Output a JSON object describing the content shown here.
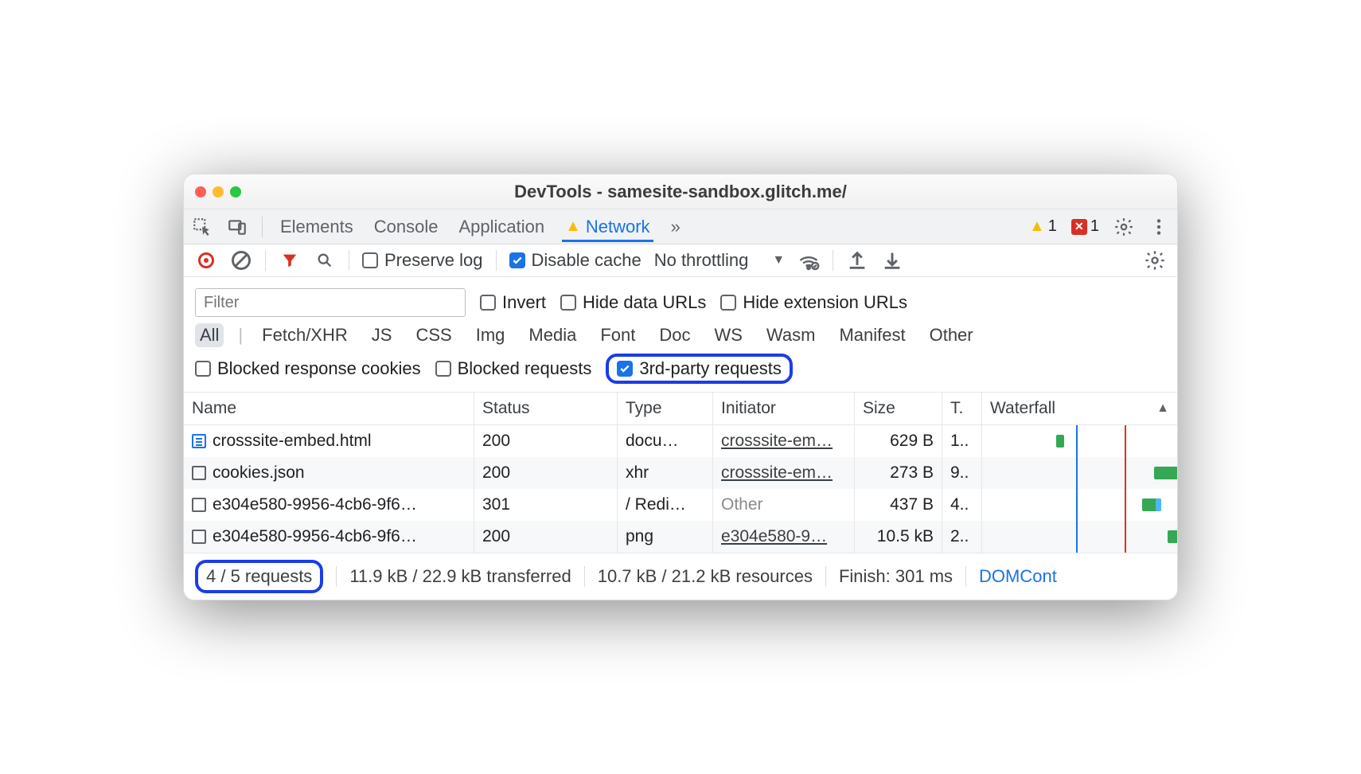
{
  "window": {
    "title": "DevTools - samesite-sandbox.glitch.me/"
  },
  "tabs": {
    "inspect_icon": "inspect",
    "device_icon": "device",
    "items": [
      "Elements",
      "Console",
      "Application",
      "Network"
    ],
    "active": "Network",
    "overflow": "»",
    "warn_count": "1",
    "err_count": "1"
  },
  "toolbar": {
    "preserve_log": "Preserve log",
    "disable_cache": "Disable cache",
    "throttling": "No throttling"
  },
  "filters": {
    "filter_placeholder": "Filter",
    "invert": "Invert",
    "hide_data": "Hide data URLs",
    "hide_ext": "Hide extension URLs",
    "types": [
      "All",
      "Fetch/XHR",
      "JS",
      "CSS",
      "Img",
      "Media",
      "Font",
      "Doc",
      "WS",
      "Wasm",
      "Manifest",
      "Other"
    ],
    "active_type": "All",
    "blocked_cookies": "Blocked response cookies",
    "blocked_requests": "Blocked requests",
    "third_party": "3rd-party requests"
  },
  "columns": {
    "name": "Name",
    "status": "Status",
    "type": "Type",
    "initiator": "Initiator",
    "size": "Size",
    "time": "T.",
    "waterfall": "Waterfall"
  },
  "rows": [
    {
      "iconType": "doc",
      "name": "crosssite-embed.html",
      "status": "200",
      "type": "docu…",
      "initiator": "crosssite-em…",
      "initLink": true,
      "size": "629 B",
      "time": "1..",
      "wf": {
        "start": 38,
        "width": 4,
        "color": "#34a853"
      }
    },
    {
      "iconType": "box",
      "name": "cookies.json",
      "status": "200",
      "type": "xhr",
      "initiator": "crosssite-em…",
      "initLink": true,
      "size": "273 B",
      "time": "9..",
      "wf": {
        "start": 88,
        "width": 14,
        "color": "#34a853"
      }
    },
    {
      "iconType": "box",
      "name": "e304e580-9956-4cb6-9f6…",
      "status": "301",
      "type": "/ Redi…",
      "initiator": "Other",
      "initLink": false,
      "size": "437 B",
      "time": "4..",
      "wf": {
        "start": 82,
        "width": 10,
        "color": "#34a853",
        "alt": "#4cb5ff"
      }
    },
    {
      "iconType": "box",
      "name": "e304e580-9956-4cb6-9f6…",
      "status": "200",
      "type": "png",
      "initiator": "e304e580-9…",
      "initLink": true,
      "size": "10.5 kB",
      "time": "2..",
      "wf": {
        "start": 95,
        "width": 6,
        "color": "#34a853"
      }
    }
  ],
  "status": {
    "requests": "4 / 5 requests",
    "transferred": "11.9 kB / 22.9 kB transferred",
    "resources": "10.7 kB / 21.2 kB resources",
    "finish": "Finish: 301 ms",
    "dom": "DOMCont"
  }
}
